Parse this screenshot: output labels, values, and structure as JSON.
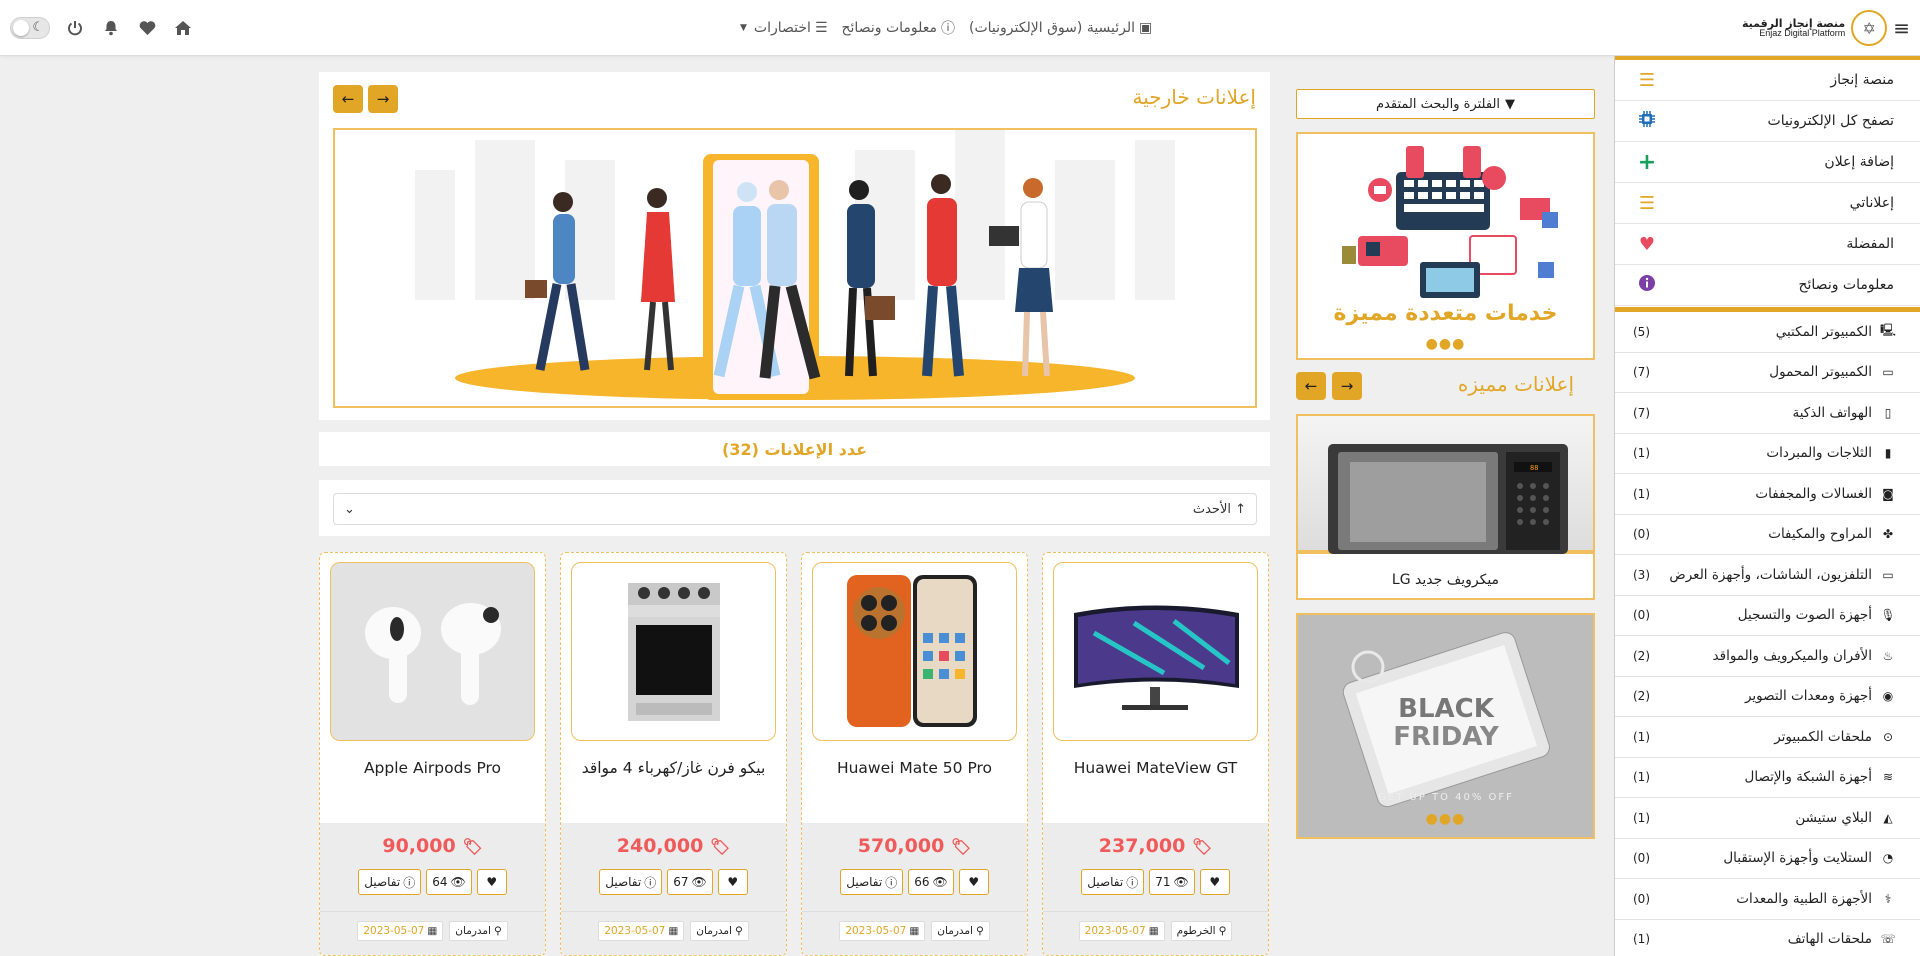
{
  "topbar": {
    "logo_ar": "منصة إنجاز الرقمية",
    "logo_en": "Enjaz Digital Platform",
    "nav_home": "الرئيسية (سوق الإلكترونيات)",
    "nav_info": "معلومات ونصائح",
    "nav_shortcuts": "اختصارات"
  },
  "sidebar": {
    "menu": [
      {
        "label": "منصة إنجاز",
        "icon": "menu-lines-icon"
      },
      {
        "label": "تصفح كل الإلكترونيات",
        "icon": "chip-icon"
      },
      {
        "label": "إضافة إعلان",
        "icon": "plus-icon"
      },
      {
        "label": "إعلاناتي",
        "icon": "list-icon"
      },
      {
        "label": "المفضلة",
        "icon": "heart-icon"
      },
      {
        "label": "معلومات ونصائح",
        "icon": "info-icon"
      }
    ],
    "categories": [
      {
        "label": "الكمبيوتر المكتبي",
        "count": "(5)"
      },
      {
        "label": "الكمبيوتر المحمول",
        "count": "(7)"
      },
      {
        "label": "الهواتف الذكية",
        "count": "(7)"
      },
      {
        "label": "الثلاجات والمبردات",
        "count": "(1)"
      },
      {
        "label": "الغسالات والمجففات",
        "count": "(1)"
      },
      {
        "label": "المراوح والمكيفات",
        "count": "(0)"
      },
      {
        "label": "التلفزيون، الشاشات، وأجهزة العرض",
        "count": "(3)"
      },
      {
        "label": "أجهزة الصوت والتسجيل",
        "count": "(0)"
      },
      {
        "label": "الأفران والميكرويف والمواقد",
        "count": "(2)"
      },
      {
        "label": "أجهزة ومعدات التصوير",
        "count": "(2)"
      },
      {
        "label": "ملحقات الكمبيوتر",
        "count": "(1)"
      },
      {
        "label": "أجهزة الشبكة والإتصال",
        "count": "(1)"
      },
      {
        "label": "البلاي ستيشن",
        "count": "(1)"
      },
      {
        "label": "الستلايت وأجهزة الإستقبال",
        "count": "(0)"
      },
      {
        "label": "الأجهزة الطبية والمعدات",
        "count": "(0)"
      },
      {
        "label": "ملحقات الهاتف",
        "count": "(1)"
      }
    ]
  },
  "filter": {
    "button": "الفلترة والبحث المتقدم",
    "services_caption": "خدمات متعددة مميزة",
    "featured_title": "إعلانات مميزه",
    "featured_caption": "ميكرويف جديد LG",
    "bf_line1": "BLACK",
    "bf_line2": "FRIDAY",
    "bf_line3": "GET UP TO 40% OFF"
  },
  "main": {
    "external_title": "إعلانات خارجية",
    "ads_count": "عدد الإعلانات (32)",
    "sort_value": "↑ الأحدث",
    "details_label": "تفاصيل"
  },
  "products": [
    {
      "name": "Huawei MateView GT",
      "price": "237,000",
      "views": "71",
      "location": "الخرطوم",
      "date": "2023-05-07"
    },
    {
      "name": "Huawei Mate 50 Pro",
      "price": "570,000",
      "views": "66",
      "location": "امدرمان",
      "date": "2023-05-07"
    },
    {
      "name": "بيكو فرن غاز/كهرباء 4 مواقد",
      "price": "240,000",
      "views": "67",
      "location": "امدرمان",
      "date": "2023-05-07"
    },
    {
      "name": "Apple Airpods Pro",
      "price": "90,000",
      "views": "64",
      "location": "امدرمان",
      "date": "2023-05-07"
    }
  ],
  "colors": {
    "accent": "#e1a626",
    "price": "#f05a5a",
    "background": "#efefef"
  }
}
